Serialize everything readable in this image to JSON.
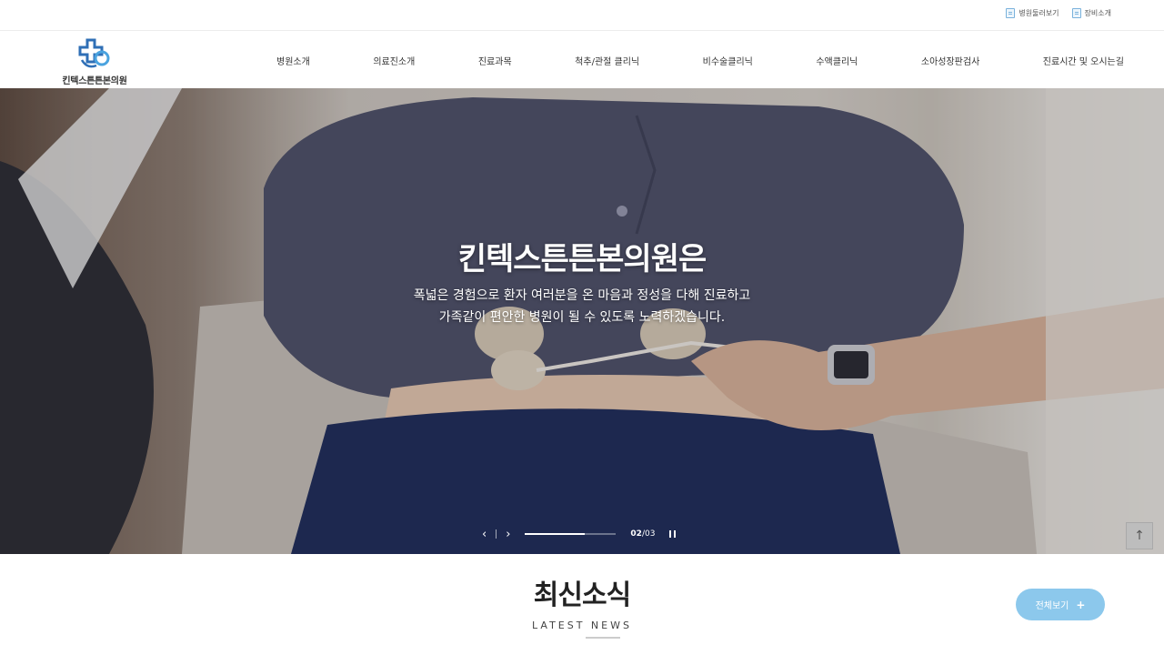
{
  "util": {
    "links": [
      {
        "label": "병원둘러보기",
        "icon": "document-icon"
      },
      {
        "label": "장비소개",
        "icon": "document-icon"
      }
    ]
  },
  "header": {
    "logo_text": "킨텍스튼튼본의원",
    "nav": [
      "병원소개",
      "의료진소개",
      "진료과목",
      "척추/관절 클리닉",
      "비수술클리닉",
      "수액클리닉",
      "소아성장판검사",
      "진료시간 및 오시는길"
    ]
  },
  "hero": {
    "title": "킨텍스튼튼본의원은",
    "subtitle_line1": "폭넓은 경험으로 환자 여러분을 온 마음과 정성을 다해 진료하고",
    "subtitle_line2": "가족같이 편안한 병원이 될 수 있도록 노력하겠습니다.",
    "prev_icon": "‹",
    "next_icon": "›",
    "current_slide": "02",
    "total_slides": "03",
    "progress": 0.66,
    "top_icon": "↑"
  },
  "news": {
    "title": "최신소식",
    "subtitle": "LATEST NEWS",
    "view_all": "전체보기",
    "plus": "+"
  },
  "colors": {
    "accent": "#8cc8ec",
    "logo_blue": "#2f6fb6"
  }
}
